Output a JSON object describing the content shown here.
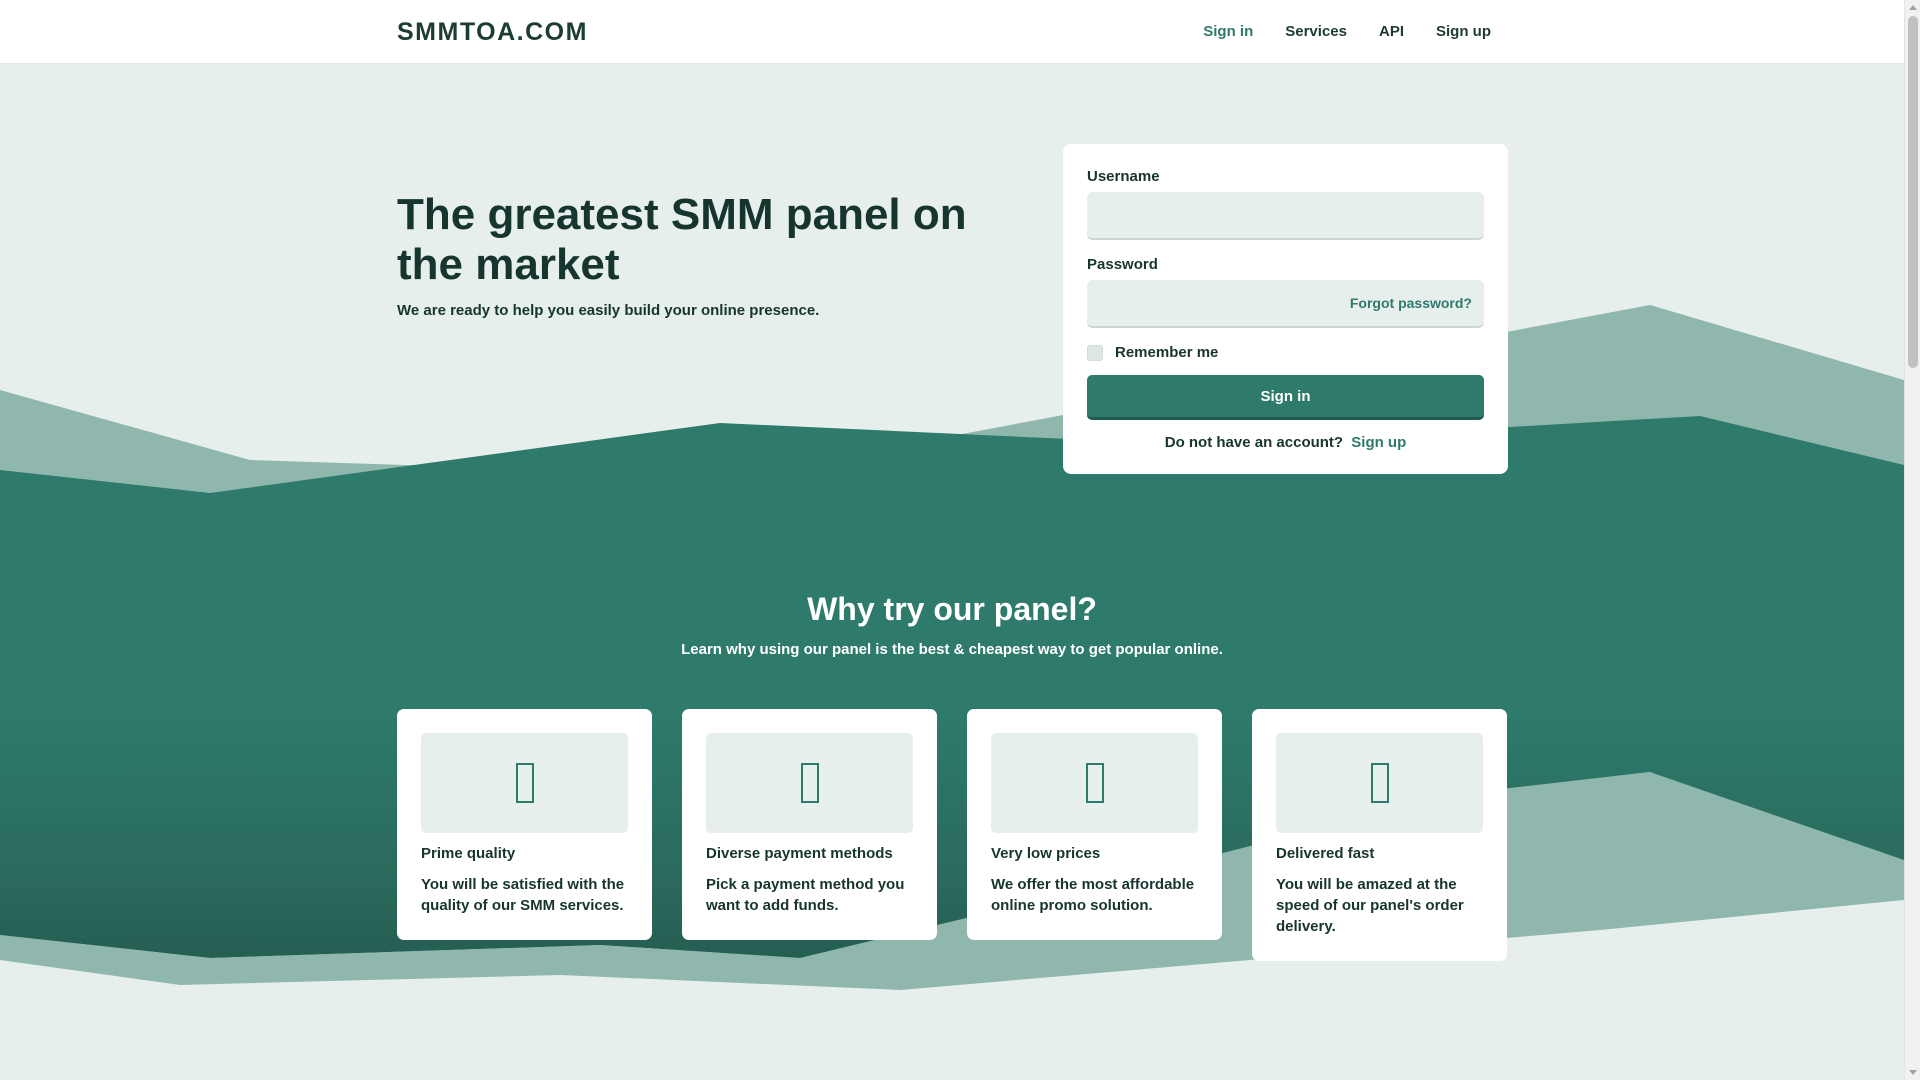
{
  "header": {
    "brand": "SMMTOA.COM",
    "nav": [
      {
        "label": "Sign in",
        "active": true
      },
      {
        "label": "Services",
        "active": false
      },
      {
        "label": "API",
        "active": false
      },
      {
        "label": "Sign up",
        "active": false
      }
    ]
  },
  "hero": {
    "title": "The greatest SMM panel on the market",
    "subtitle": "We are ready to help you easily build your online presence."
  },
  "login": {
    "username_label": "Username",
    "username_value": "",
    "password_label": "Password",
    "password_value": "",
    "forgot_label": "Forgot password?",
    "remember_label": "Remember me",
    "remember_checked": false,
    "submit_label": "Sign in",
    "no_account_text": "Do not have an account?",
    "signup_link": "Sign up"
  },
  "why": {
    "title": "Why try our panel?",
    "subtitle": "Learn why using our panel is the best & cheapest way to get popular online."
  },
  "features": [
    {
      "icon": "missing-glyph-icon",
      "title": "Prime quality",
      "text": "You will be satisfied with the quality of our SMM services."
    },
    {
      "icon": "missing-glyph-icon",
      "title": "Diverse payment methods",
      "text": "Pick a payment method you want to add funds."
    },
    {
      "icon": "missing-glyph-icon",
      "title": "Very low prices",
      "text": "We offer the most affordable online promo solution."
    },
    {
      "icon": "missing-glyph-icon",
      "title": "Delivered fast",
      "text": "You will be amazed at the speed of our panel's order delivery."
    }
  ],
  "colors": {
    "page_background": "#e7efed",
    "accent": "#2e7a6b",
    "mountain_light": "#8fb7ad",
    "mountain_dark": "#2e7a6b",
    "text_dark": "#17352f"
  }
}
